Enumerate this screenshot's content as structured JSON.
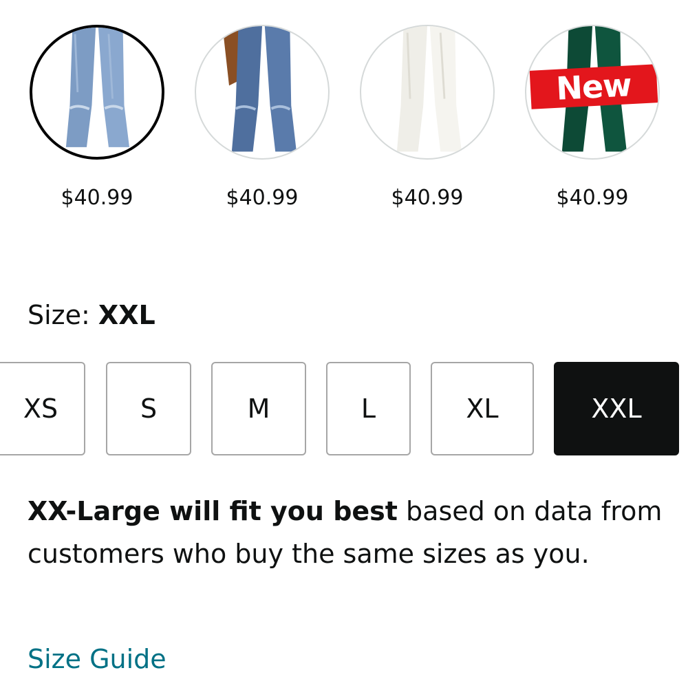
{
  "swatches": [
    {
      "price": "$40.99",
      "color_name": "light-blue-denim",
      "color": "#7d9cc4",
      "selected": true
    },
    {
      "price": "$40.99",
      "color_name": "medium-blue-denim",
      "color": "#4f6f9e",
      "selected": false
    },
    {
      "price": "$40.99",
      "color_name": "white",
      "color": "#f2f1ec",
      "selected": false
    },
    {
      "price": "$40.99",
      "color_name": "dark-green",
      "color": "#0d4a36",
      "selected": false,
      "badge": "New"
    }
  ],
  "size": {
    "label": "Size:",
    "selected_value": "XXL",
    "options": [
      "XS",
      "S",
      "M",
      "L",
      "XL",
      "XXL"
    ]
  },
  "recommendation": {
    "bold_part": "XX-Large will fit you best",
    "rest": " based on data from customers who buy the same sizes as you."
  },
  "size_guide_link": "Size Guide",
  "colors": {
    "selected_button_bg": "#0f1111",
    "link": "#007185",
    "badge": "#e3161c"
  }
}
